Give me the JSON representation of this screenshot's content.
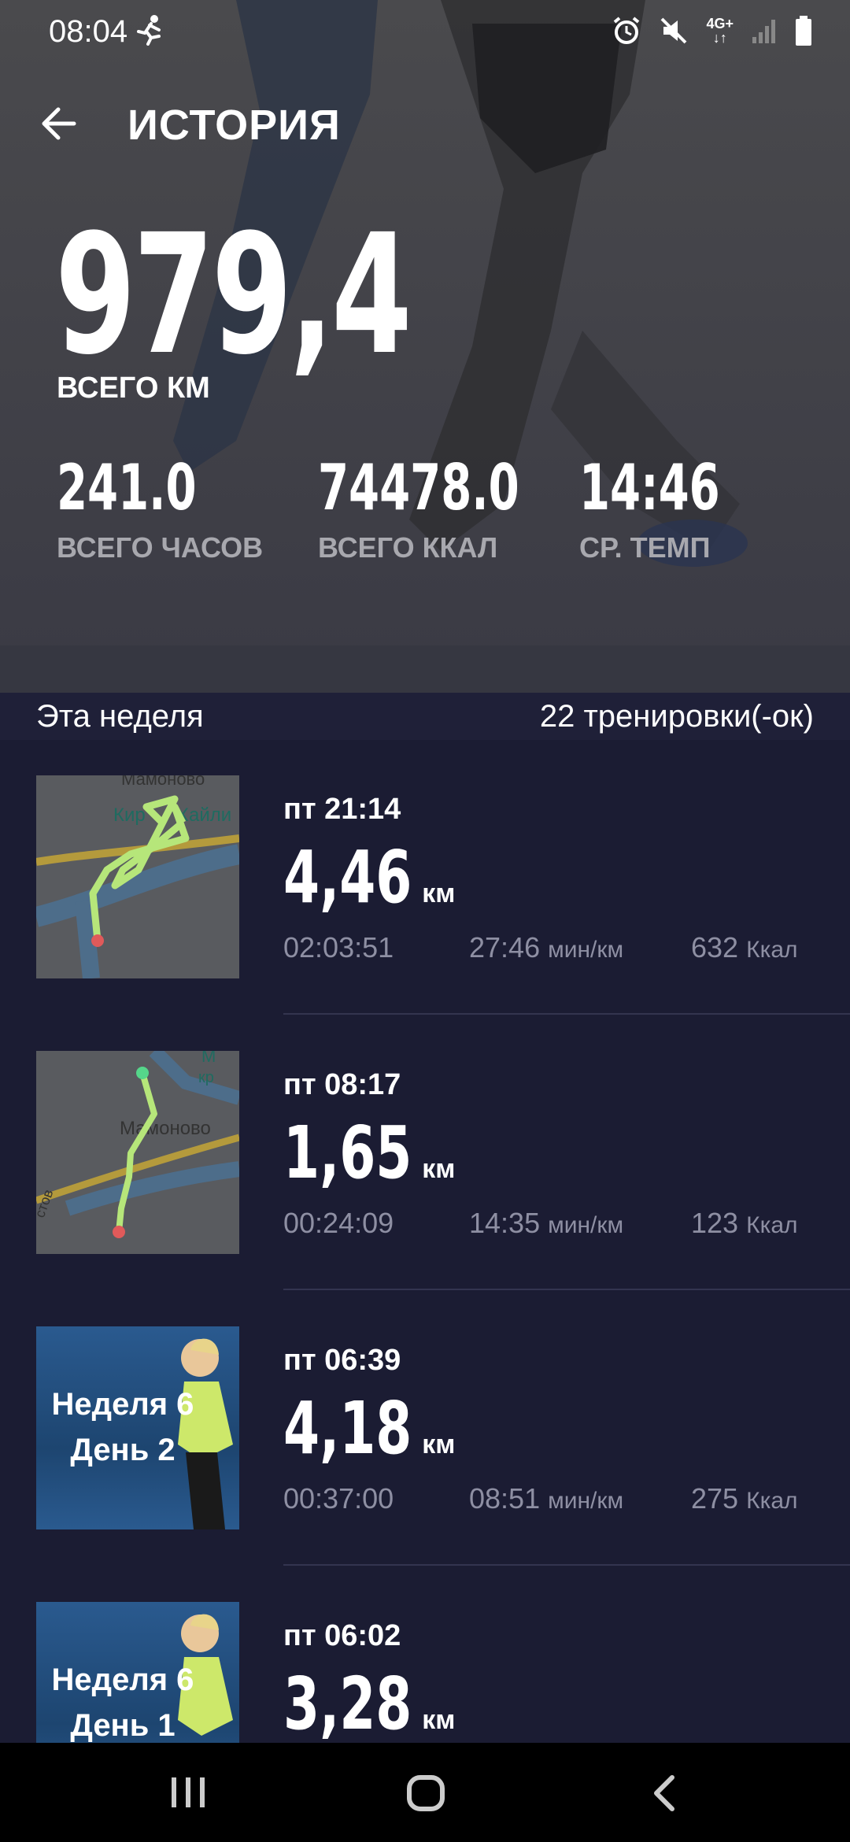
{
  "status_bar": {
    "time": "08:04",
    "network": "4G+",
    "icons": [
      "running-icon",
      "alarm-icon",
      "mute-icon",
      "network-icon",
      "signal-icon",
      "battery-icon"
    ]
  },
  "header": {
    "title": "ИСТОРИЯ",
    "back_icon": "arrow-left-icon"
  },
  "summary": {
    "total_km": "979,4",
    "total_km_label": "ВСЕГО КМ",
    "stats": [
      {
        "value": "241.0",
        "label": "ВСЕГО ЧАСОВ"
      },
      {
        "value": "74478.0",
        "label": "ВСЕГО ККАЛ"
      },
      {
        "value": "14:46",
        "label": "СР. ТЕМП"
      }
    ]
  },
  "week": {
    "title": "Эта неделя",
    "count": "22 тренировки(-ок)"
  },
  "workouts": [
    {
      "day": "пт 21:14",
      "distance": "4,46",
      "unit": "км",
      "duration": "02:03:51",
      "pace": "27:46",
      "pace_unit": "мин/км",
      "kcal": "632",
      "kcal_unit": "Ккал",
      "thumb": "map",
      "map_labels": [
        "Мамоново",
        "Кир",
        "Хайли"
      ]
    },
    {
      "day": "пт 08:17",
      "distance": "1,65",
      "unit": "км",
      "duration": "00:24:09",
      "pace": "14:35",
      "pace_unit": "мин/км",
      "kcal": "123",
      "kcal_unit": "Ккал",
      "thumb": "map",
      "map_labels": [
        "Мамоново",
        "М",
        "кр",
        "стов"
      ]
    },
    {
      "day": "пт 06:39",
      "distance": "4,18",
      "unit": "км",
      "duration": "00:37:00",
      "pace": "08:51",
      "pace_unit": "мин/км",
      "kcal": "275",
      "kcal_unit": "Ккал",
      "thumb": "plan",
      "plan_line1": "Неделя 6",
      "plan_line2": "День 2"
    },
    {
      "day": "пт 06:02",
      "distance": "3,28",
      "unit": "км",
      "thumb": "plan",
      "plan_line1": "Неделя 6",
      "plan_line2": "День 1"
    }
  ],
  "colors": {
    "background": "#1b1c33",
    "route": "#b6e67a",
    "accent_text": "#ffffff",
    "secondary_text": "#8e8fa3"
  },
  "nav": {
    "icons": [
      "recent-apps-icon",
      "home-icon",
      "back-icon"
    ]
  }
}
